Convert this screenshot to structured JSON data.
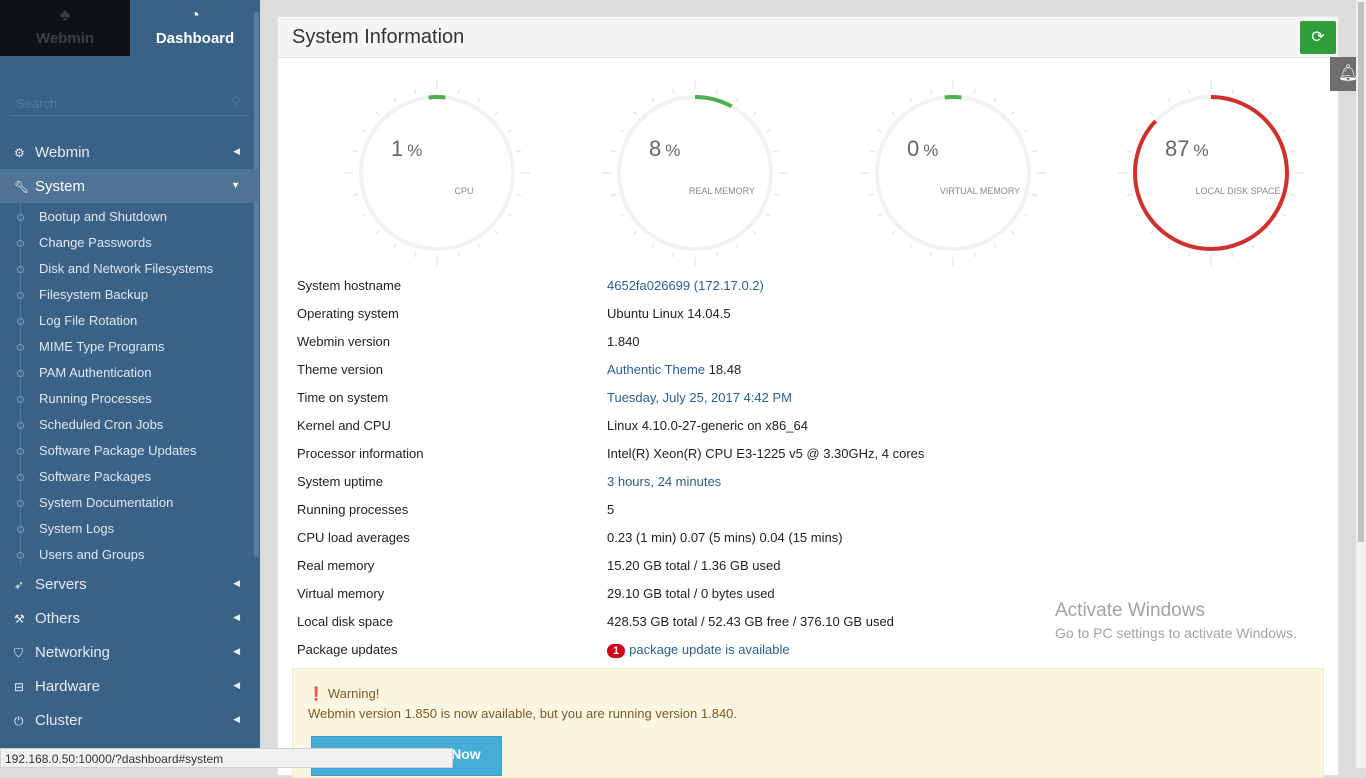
{
  "sidebar": {
    "tabs": [
      {
        "label": "Webmin",
        "icon": "webmin-logo-icon"
      },
      {
        "label": "Dashboard",
        "icon": "dashboard-icon"
      }
    ],
    "search_placeholder": "Search",
    "categories": [
      {
        "label": "Webmin",
        "icon": "gear-icon",
        "expanded": false
      },
      {
        "label": "System",
        "icon": "wrench-icon",
        "expanded": true
      },
      {
        "label": "Servers",
        "icon": "rocket-icon",
        "expanded": false
      },
      {
        "label": "Others",
        "icon": "gavel-icon",
        "expanded": false
      },
      {
        "label": "Networking",
        "icon": "shield-icon",
        "expanded": false
      },
      {
        "label": "Hardware",
        "icon": "hdd-icon",
        "expanded": false
      },
      {
        "label": "Cluster",
        "icon": "power-icon",
        "expanded": false
      }
    ],
    "system_items": [
      "Bootup and Shutdown",
      "Change Passwords",
      "Disk and Network Filesystems",
      "Filesystem Backup",
      "Log File Rotation",
      "MIME Type Programs",
      "PAM Authentication",
      "Running Processes",
      "Scheduled Cron Jobs",
      "Software Package Updates",
      "Software Packages",
      "System Documentation",
      "System Logs",
      "Users and Groups"
    ]
  },
  "panel": {
    "title": "System Information",
    "refresh_icon": "refresh-icon"
  },
  "gauges": [
    {
      "value": 1,
      "unit": "%",
      "label": "CPU",
      "color": "#4caf50"
    },
    {
      "value": 8,
      "unit": "%",
      "label": "REAL MEMORY",
      "color": "#4caf50"
    },
    {
      "value": 0,
      "unit": "%",
      "label": "VIRTUAL MEMORY",
      "color": "#4caf50"
    },
    {
      "value": 87,
      "unit": "%",
      "label": "LOCAL DISK SPACE",
      "color": "#d0312d"
    }
  ],
  "info": [
    {
      "label": "System hostname",
      "value": "4652fa026699 (172.17.0.2)",
      "link": true
    },
    {
      "label": "Operating system",
      "value": "Ubuntu Linux 14.04.5"
    },
    {
      "label": "Webmin version",
      "value": "1.840"
    },
    {
      "label": "Theme version",
      "value": "Authentic Theme",
      "value2": " 18.48",
      "link": true
    },
    {
      "label": "Time on system",
      "value": "Tuesday, July 25, 2017 4:42 PM",
      "link": true
    },
    {
      "label": "Kernel and CPU",
      "value": "Linux 4.10.0-27-generic on x86_64"
    },
    {
      "label": "Processor information",
      "value": "Intel(R) Xeon(R) CPU E3-1225 v5 @ 3.30GHz, 4 cores"
    },
    {
      "label": "System uptime",
      "value": "3 hours, 24 minutes",
      "link": true
    },
    {
      "label": "Running processes",
      "value": "5"
    },
    {
      "label": "CPU load averages",
      "value": "0.23 (1 min) 0.07 (5 mins) 0.04 (15 mins)"
    },
    {
      "label": "Real memory",
      "value": "15.20 GB total / 1.36 GB used"
    },
    {
      "label": "Virtual memory",
      "value": "29.10 GB total / 0 bytes used"
    },
    {
      "label": "Local disk space",
      "value": "428.53 GB total / 52.43 GB free / 376.10 GB used"
    },
    {
      "label": "Package updates",
      "badge": "1",
      "value": "package update is available",
      "link": true
    }
  ],
  "warning": {
    "title": "Warning!",
    "message": "Webmin version 1.850 is now available, but you are running version 1.840.",
    "button": "Upgrade Webmin Now"
  },
  "status_url": "192.168.0.50:10000/?dashboard#system",
  "watermark": {
    "line1": "Activate Windows",
    "line2": "Go to PC settings to activate Windows."
  }
}
